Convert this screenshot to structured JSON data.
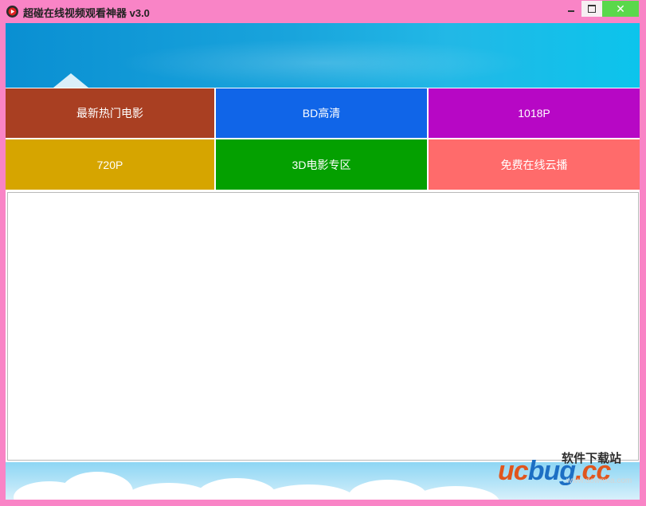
{
  "window": {
    "title": "超碰在线视频观看神器 v3.0",
    "close_glyph": "✕"
  },
  "tiles": [
    {
      "label": "最新热门电影",
      "color": "#a93f22"
    },
    {
      "label": "BD高清",
      "color": "#1065e8"
    },
    {
      "label": "1018P",
      "color": "#b707c5"
    },
    {
      "label": "720P",
      "color": "#d6a500"
    },
    {
      "label": "3D电影专区",
      "color": "#04a000"
    },
    {
      "label": "免费在线云播",
      "color": "#ff6b6b"
    }
  ],
  "watermark": {
    "logo_prefix": "uc",
    "logo_suffix": "bug",
    "logo_tld": ".cc",
    "site_name": "软件下载站",
    "site_url": "www.downxia.com"
  },
  "colors": {
    "frame": "#f984c6",
    "close_button": "#5ad84b",
    "banner": "#19a4dc"
  }
}
